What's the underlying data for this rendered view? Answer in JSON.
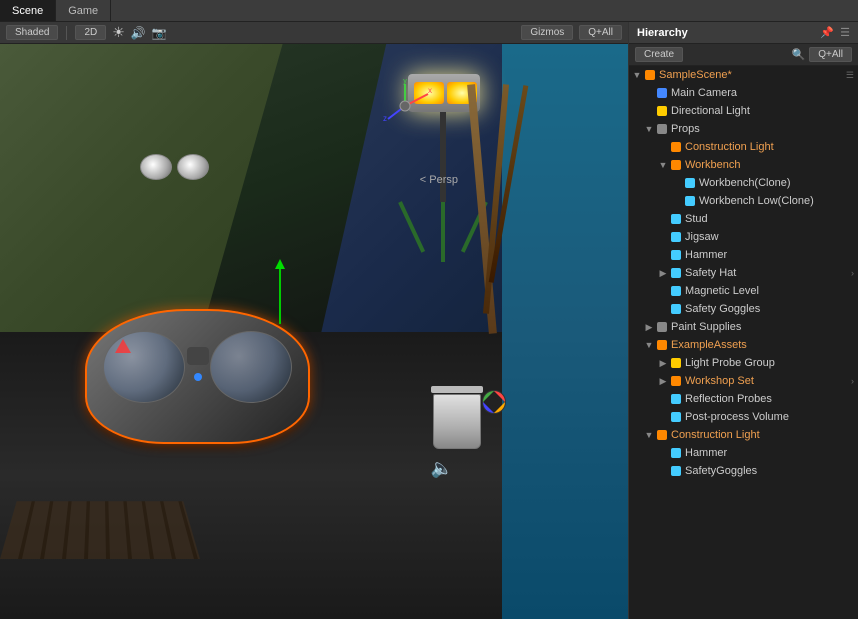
{
  "tabs": [
    {
      "label": "Scene",
      "active": false
    },
    {
      "label": "Game",
      "active": false
    }
  ],
  "viewport": {
    "shading": "Shaded",
    "mode": "2D",
    "gizmos": "Gizmos",
    "all": "Q+All",
    "persp": "<  Persp"
  },
  "hierarchy": {
    "title": "Hierarchy",
    "create_btn": "Create",
    "all_btn": "Q+All",
    "items": [
      {
        "id": "sample-scene",
        "label": "SampleScene*",
        "indent": 0,
        "icon": "scene",
        "color": "orange",
        "expandable": true,
        "expanded": true
      },
      {
        "id": "main-camera",
        "label": "Main Camera",
        "indent": 1,
        "icon": "camera",
        "color": "blue",
        "expandable": false
      },
      {
        "id": "directional-light",
        "label": "Directional Light",
        "indent": 1,
        "icon": "light",
        "color": "yellow",
        "expandable": false
      },
      {
        "id": "props",
        "label": "Props",
        "indent": 1,
        "icon": "folder",
        "color": "grey",
        "expandable": true,
        "expanded": true
      },
      {
        "id": "construction-light-1",
        "label": "Construction Light",
        "indent": 2,
        "icon": "object",
        "color": "orange",
        "expandable": false
      },
      {
        "id": "workbench",
        "label": "Workbench",
        "indent": 2,
        "icon": "object",
        "color": "orange",
        "expandable": true,
        "expanded": true
      },
      {
        "id": "workbench-clone",
        "label": "Workbench(Clone)",
        "indent": 3,
        "icon": "object",
        "color": "cyan",
        "expandable": false
      },
      {
        "id": "workbench-low-clone",
        "label": "Workbench Low(Clone)",
        "indent": 3,
        "icon": "object",
        "color": "cyan",
        "expandable": false
      },
      {
        "id": "stud",
        "label": "Stud",
        "indent": 2,
        "icon": "object",
        "color": "cyan",
        "expandable": false
      },
      {
        "id": "jigsaw",
        "label": "Jigsaw",
        "indent": 2,
        "icon": "object",
        "color": "cyan",
        "expandable": false
      },
      {
        "id": "hammer",
        "label": "Hammer",
        "indent": 2,
        "icon": "object",
        "color": "cyan",
        "expandable": false
      },
      {
        "id": "safety-hat",
        "label": "Safety Hat",
        "indent": 2,
        "icon": "object",
        "color": "cyan",
        "expandable": true
      },
      {
        "id": "magnetic-level",
        "label": "Magnetic Level",
        "indent": 2,
        "icon": "object",
        "color": "cyan",
        "expandable": false
      },
      {
        "id": "safety-goggles",
        "label": "Safety Goggles",
        "indent": 2,
        "icon": "object",
        "color": "cyan",
        "expandable": false
      },
      {
        "id": "paint-supplies",
        "label": "Paint Supplies",
        "indent": 1,
        "icon": "folder",
        "color": "grey",
        "expandable": true
      },
      {
        "id": "example-assets",
        "label": "ExampleAssets",
        "indent": 1,
        "icon": "folder",
        "color": "orange",
        "expandable": true,
        "expanded": true
      },
      {
        "id": "light-probe-group",
        "label": "Light Probe Group",
        "indent": 2,
        "icon": "probe",
        "color": "yellow",
        "expandable": true
      },
      {
        "id": "workshop-set",
        "label": "Workshop Set",
        "indent": 2,
        "icon": "object",
        "color": "orange",
        "expandable": true
      },
      {
        "id": "reflection-probes",
        "label": "Reflection Probes",
        "indent": 2,
        "icon": "probe2",
        "color": "cyan",
        "expandable": false
      },
      {
        "id": "post-process-volume",
        "label": "Post-process Volume",
        "indent": 2,
        "icon": "object",
        "color": "cyan",
        "expandable": false
      },
      {
        "id": "construction-light-2",
        "label": "Construction Light",
        "indent": 1,
        "icon": "object",
        "color": "orange",
        "expandable": false
      },
      {
        "id": "hammer-2",
        "label": "Hammer",
        "indent": 2,
        "icon": "object",
        "color": "cyan",
        "expandable": false
      },
      {
        "id": "safety-goggles-2",
        "label": "SafetyGoggles",
        "indent": 2,
        "icon": "object",
        "color": "cyan",
        "expandable": false
      }
    ]
  }
}
